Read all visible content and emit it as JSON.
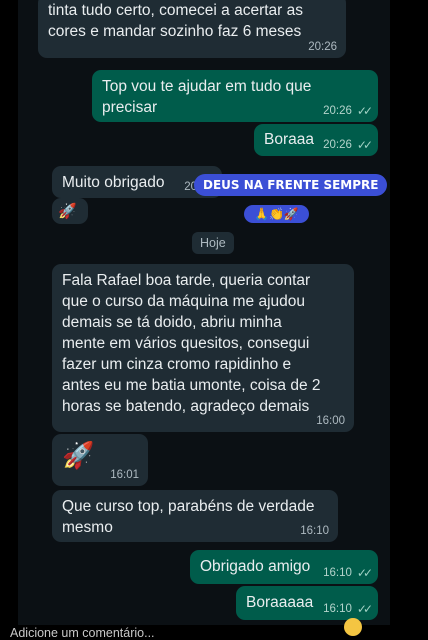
{
  "messages": [
    {
      "dir": "in",
      "text": "tinta tudo certo, comecei a acertar as\ncores e mandar sozinho faz 6 meses",
      "time": "20:26"
    },
    {
      "dir": "out",
      "text": "Top vou te ajudar em tudo que\nprecisar",
      "time": "20:26"
    },
    {
      "dir": "out",
      "text": "Boraaa",
      "time": "20:26"
    },
    {
      "dir": "in",
      "text": "Muito obrigado",
      "time": "20:26"
    },
    {
      "dir": "in",
      "text": "🚀",
      "time": ""
    },
    {
      "dir": "in",
      "text": "Fala Rafael boa tarde, queria contar\nque o curso da máquina me ajudou\ndemais se tá doido, abriu minha\nmente em vários quesitos, consegui\nfazer um cinza cromo rapidinho e\nantes eu me batia umonte, coisa de 2\nhoras se batendo, agradeço demais",
      "time": "16:00"
    },
    {
      "dir": "in",
      "text": "🚀",
      "time": "16:01"
    },
    {
      "dir": "in",
      "text": "Que curso top, parabéns de verdade\nmesmo",
      "time": "16:10"
    },
    {
      "dir": "out",
      "text": "Obrigado amigo",
      "time": "16:10"
    },
    {
      "dir": "out",
      "text": "Boraaaaa",
      "time": "16:10"
    }
  ],
  "date_divider": "Hoje",
  "stickers": {
    "banner": "DEUS NA FRENTE SEMPRE",
    "emojis": "🙏👏🚀"
  },
  "comment_placeholder": "Adicione um comentário...",
  "colors": {
    "incoming": "#1f2c34",
    "outgoing": "#005c4b",
    "background": "#0b1014",
    "banner": "#3b4fd6"
  }
}
